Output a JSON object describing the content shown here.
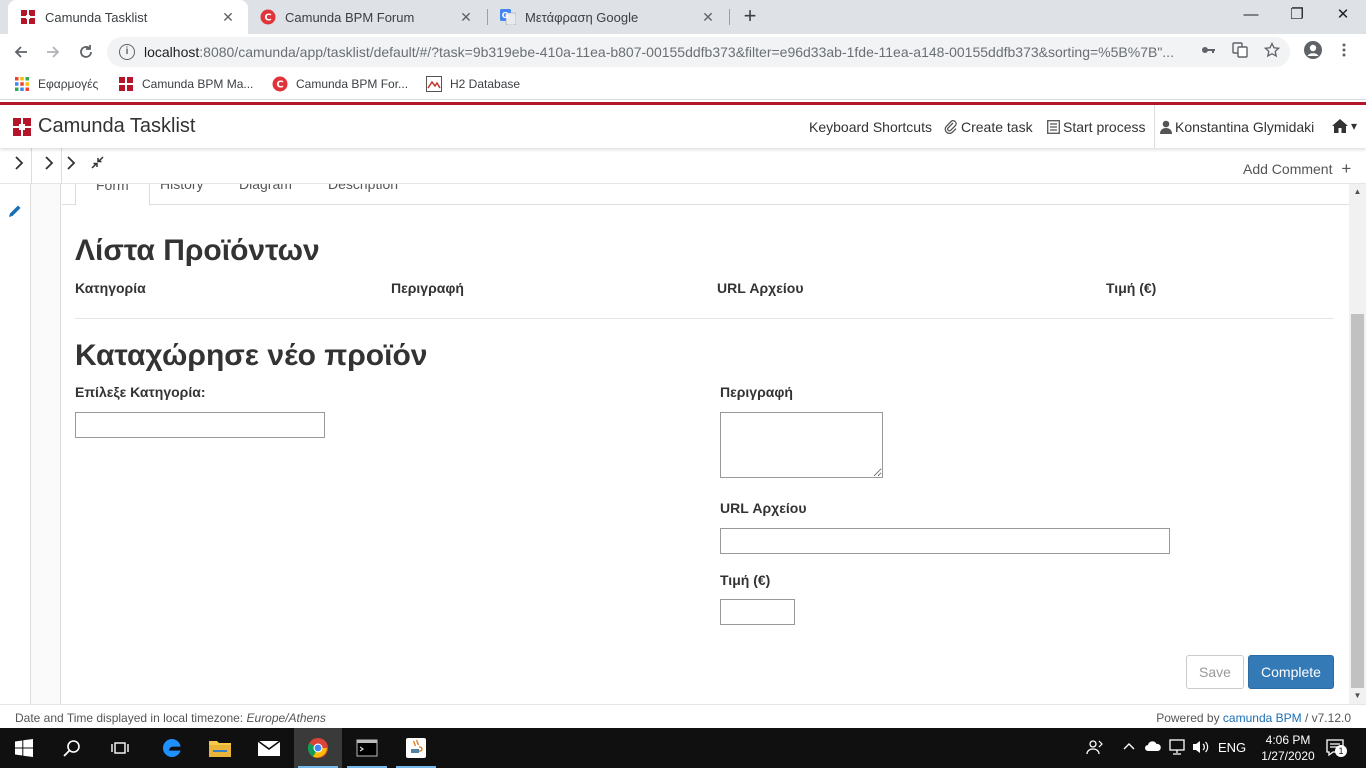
{
  "browser": {
    "tabs": [
      {
        "title": "Camunda Tasklist",
        "active": true
      },
      {
        "title": "Camunda BPM Forum",
        "active": false
      },
      {
        "title": "Μετάφραση Google",
        "active": false
      }
    ],
    "close_glyph": "✕",
    "new_tab_glyph": "+",
    "window_controls": {
      "minimize": "—",
      "maximize": "❐",
      "close": "✕"
    },
    "url_host": "localhost",
    "url_rest": ":8080/camunda/app/tasklist/default/#/?task=9b319ebe-410a-11ea-b807-00155ddfb373&filter=e96d33ab-1fde-11ea-a148-00155ddfb373&sorting=%5B%7B\"...",
    "bookmarks": [
      {
        "label": "Εφαρμογές",
        "icon": "apps-grid-icon"
      },
      {
        "label": "Camunda BPM Ma...",
        "icon": "camunda-icon"
      },
      {
        "label": "Camunda BPM For...",
        "icon": "camunda-forum-icon"
      },
      {
        "label": "H2 Database",
        "icon": "h2-icon"
      }
    ]
  },
  "header": {
    "brand": "Camunda Tasklist",
    "keyboard_shortcuts": "Keyboard Shortcuts",
    "create_task": "Create task",
    "start_process": "Start process",
    "user": "Konstantina Glymidaki",
    "caret": "▾"
  },
  "toolbar": {
    "add_comment": "Add Comment",
    "plus": "+"
  },
  "task_tabs": [
    "Form",
    "History",
    "Diagram",
    "Description"
  ],
  "form": {
    "product_list_title": "Λίστα Προϊόντων",
    "table_headers": [
      "Κατηγορία",
      "Περιγραφή",
      "URL Αρχείου",
      "Τιμή (€)"
    ],
    "new_product_title": "Καταχώρησε νέο προϊόν",
    "category_label": "Επίλεξε Κατηγορία:",
    "category_value": "",
    "description_label": "Περιγραφή",
    "description_value": "",
    "url_label": "URL Αρχείου",
    "url_value": "",
    "price_label": "Τιμή (€)",
    "price_value": "",
    "save_label": "Save",
    "complete_label": "Complete"
  },
  "footer": {
    "timezone_prefix": "Date and Time displayed in local timezone:",
    "timezone": "Europe/Athens",
    "powered_prefix": "Powered by",
    "powered_link": "camunda BPM",
    "version": "/ v7.12.0"
  },
  "taskbar": {
    "language": "ENG",
    "time": "4:06 PM",
    "date": "1/27/2020",
    "notification_count": "1"
  },
  "colors": {
    "brand_red": "#b5152b",
    "primary_blue": "#337ab7",
    "link_blue": "#1a6fb5"
  }
}
